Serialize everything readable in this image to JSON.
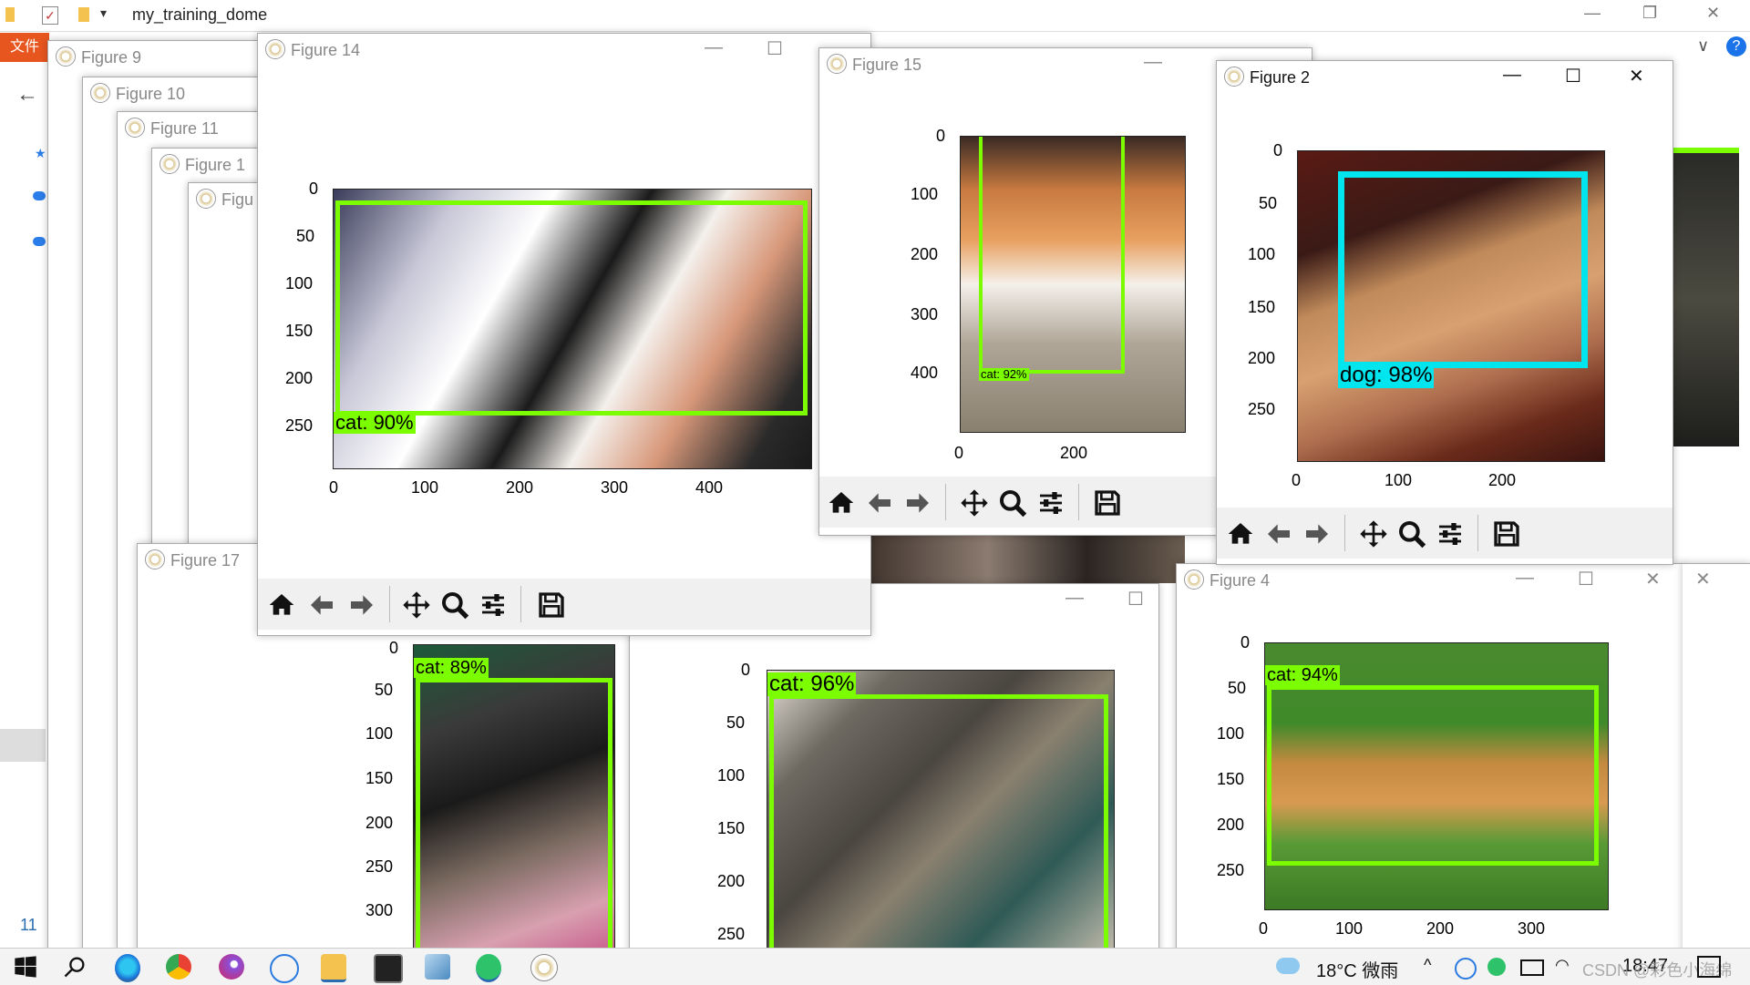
{
  "explorer": {
    "title": "my_training_dome",
    "file_tab": "文件",
    "left_number": "11"
  },
  "figures": {
    "f9": "Figure 9",
    "f10": "Figure 10",
    "f11": "Figure 11",
    "f1x": "Figure 1",
    "fig": "Figu",
    "f14": "Figure 14",
    "f15": "Figure 15",
    "f2": "Figure 2",
    "f17": "Figure 17",
    "f4": "Figure 4"
  },
  "detections": {
    "f14": "cat: 90%",
    "f15": "cat: 92%",
    "f2": "dog: 98%",
    "f17": "cat: 89%",
    "mid": "cat: 96%",
    "f4": "cat: 94%"
  },
  "axes": {
    "f14_y": [
      "0",
      "50",
      "100",
      "150",
      "200",
      "250"
    ],
    "f14_x": [
      "0",
      "100",
      "200",
      "300",
      "400"
    ],
    "f15_y": [
      "0",
      "100",
      "200",
      "300",
      "400"
    ],
    "f15_x": [
      "0",
      "200"
    ],
    "f2_y": [
      "0",
      "50",
      "100",
      "150",
      "200",
      "250"
    ],
    "f2_x": [
      "0",
      "100",
      "200"
    ],
    "f17_y": [
      "0",
      "50",
      "100",
      "150",
      "200",
      "250",
      "300"
    ],
    "mid_y": [
      "0",
      "50",
      "100",
      "150",
      "200",
      "250"
    ],
    "f4_y": [
      "0",
      "50",
      "100",
      "150",
      "200",
      "250"
    ],
    "f4_x": [
      "0",
      "100",
      "200",
      "300"
    ]
  },
  "toolbar_icons": [
    "home-icon",
    "back-arrow-icon",
    "forward-arrow-icon",
    "pan-icon",
    "zoom-icon",
    "configure-icon",
    "save-icon"
  ],
  "taskbar": {
    "weather": "18°C 微雨",
    "time": "18:47",
    "watermark": "CSDN @彩色小海绵"
  },
  "colors": {
    "green_box": "#7cfc00",
    "cyan_box": "#00e5ee"
  }
}
